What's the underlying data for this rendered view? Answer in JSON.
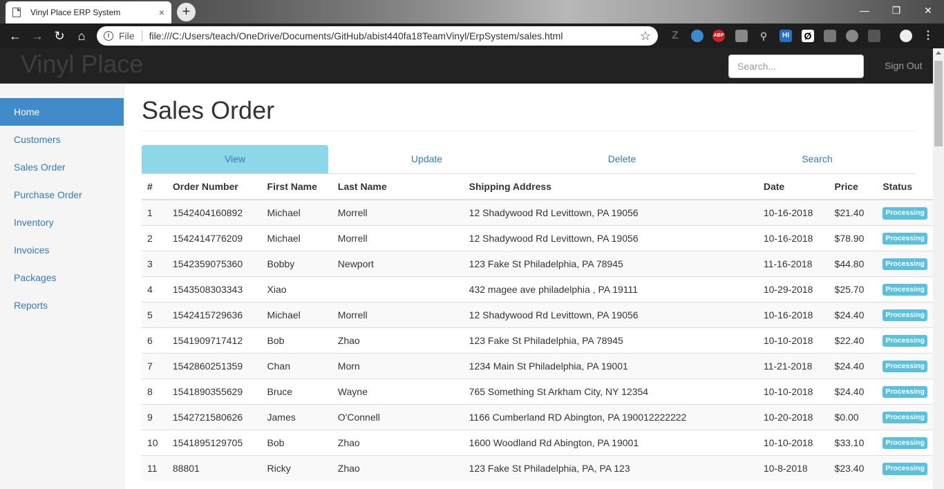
{
  "browser": {
    "tab_title": "Vinyl Place ERP System",
    "tab_close": "×",
    "new_tab": "+",
    "url_scheme": "File",
    "url": "file:///C:/Users/teach/OneDrive/Documents/GitHub/abist440fa18TeamVinyl/ErpSystem/sales.html",
    "window_controls": {
      "minimize": "—",
      "maximize": "❐",
      "close": "✕"
    },
    "extensions": [
      "Z",
      "",
      "ABP",
      "",
      "⚲",
      "HI",
      "Ø",
      "",
      "",
      "",
      "",
      "⋮"
    ]
  },
  "header": {
    "brand": "Vinyl Place",
    "search_placeholder": "Search...",
    "sign_out": "Sign Out"
  },
  "sidebar": {
    "items": [
      {
        "label": "Home",
        "active": true
      },
      {
        "label": "Customers"
      },
      {
        "label": "Sales Order"
      },
      {
        "label": "Purchase Order"
      },
      {
        "label": "Inventory"
      },
      {
        "label": "Invoices"
      },
      {
        "label": "Packages"
      },
      {
        "label": "Reports"
      }
    ]
  },
  "page": {
    "title": "Sales Order",
    "tabs": [
      "View",
      "Update",
      "Delete",
      "Search"
    ],
    "active_tab": "View"
  },
  "table": {
    "columns": [
      "#",
      "Order Number",
      "First Name",
      "Last Name",
      "Shipping Address",
      "Date",
      "Price",
      "Status"
    ],
    "rows": [
      [
        "1",
        "1542404160892",
        "Michael",
        "Morrell",
        "12 Shadywood Rd Levittown, PA 19056",
        "10-16-2018",
        "$21.40",
        "Processing"
      ],
      [
        "2",
        "1542414776209",
        "Michael",
        "Morrell",
        "12 Shadywood Rd Levittown, PA 19056",
        "10-16-2018",
        "$78.90",
        "Processing"
      ],
      [
        "3",
        "1542359075360",
        "Bobby",
        "Newport",
        "123 Fake St Philadelphia, PA 78945",
        "11-16-2018",
        "$44.80",
        "Processing"
      ],
      [
        "4",
        "1543508303343",
        "Xiao",
        "",
        "432 magee ave philadelphia , PA 19111",
        "10-29-2018",
        "$25.70",
        "Processing"
      ],
      [
        "5",
        "1542415729636",
        "Michael",
        "Morrell",
        "12 Shadywood Rd Levittown, PA 19056",
        "10-16-2018",
        "$24.40",
        "Processing"
      ],
      [
        "6",
        "1541909717412",
        "Bob",
        "Zhao",
        "123 Fake St Philadelphia, PA 78945",
        "10-10-2018",
        "$22.40",
        "Processing"
      ],
      [
        "7",
        "1542860251359",
        "Chan",
        "Morn",
        "1234 Main St Philadelphia, PA 19001",
        "11-21-2018",
        "$24.40",
        "Processing"
      ],
      [
        "8",
        "1541890355629",
        "Bruce",
        "Wayne",
        "765 Something St Arkham City, NY 12354",
        "10-10-2018",
        "$24.40",
        "Processing"
      ],
      [
        "9",
        "1542721580626",
        "James",
        "O'Connell",
        "1166 Cumberland RD Abington, PA 190012222222",
        "10-20-2018",
        "$0.00",
        "Processing"
      ],
      [
        "10",
        "1541895129705",
        "Bob",
        "Zhao",
        "1600 Woodland Rd Abington, PA 19001",
        "10-10-2018",
        "$33.10",
        "Processing"
      ],
      [
        "11",
        "88801",
        "Ricky",
        "Zhao",
        "123 Fake St Philadelphia, PA, PA 123",
        "10-8-2018",
        "$23.40",
        "Processing"
      ]
    ]
  },
  "colors": {
    "header_bg": "#222222",
    "active_nav": "#428bca",
    "active_tab": "#8cd8e8",
    "status_label": "#5bc0de",
    "link": "#337ab7"
  }
}
